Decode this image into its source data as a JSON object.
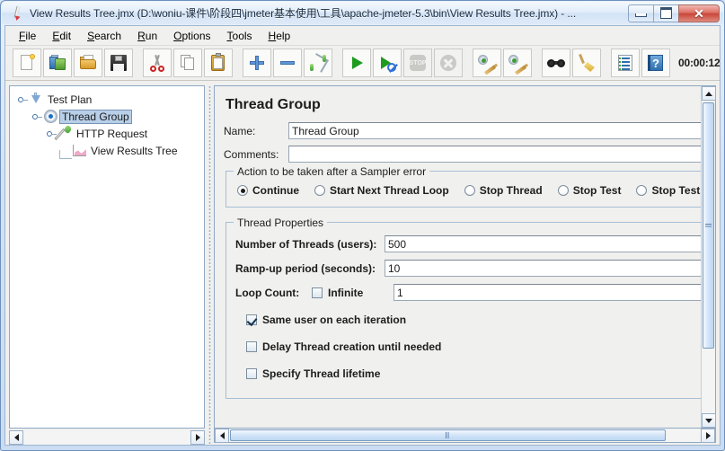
{
  "window": {
    "title": "View Results Tree.jmx (D:\\woniu-课件\\阶段四\\jmeter基本使用\\工具\\apache-jmeter-5.3\\bin\\View Results Tree.jmx) - ...",
    "minimize_label": "",
    "maximize_label": "",
    "close_label": "✕"
  },
  "menubar": {
    "items": [
      {
        "label": "File",
        "mnemonic": "F"
      },
      {
        "label": "Edit",
        "mnemonic": "E"
      },
      {
        "label": "Search",
        "mnemonic": "S"
      },
      {
        "label": "Run",
        "mnemonic": "R"
      },
      {
        "label": "Options",
        "mnemonic": "O"
      },
      {
        "label": "Tools",
        "mnemonic": "T"
      },
      {
        "label": "Help",
        "mnemonic": "H"
      }
    ]
  },
  "toolbar": {
    "buttons": [
      {
        "icon": "new-test-plan-icon",
        "name": "new-button",
        "enabled": true
      },
      {
        "icon": "templates-icon",
        "name": "templates-button",
        "enabled": true
      },
      {
        "icon": "open-folder-icon",
        "name": "open-button",
        "enabled": true
      },
      {
        "icon": "save-disk-icon",
        "name": "save-button",
        "enabled": true
      },
      {
        "icon": "scissors-icon",
        "name": "cut-button",
        "enabled": true
      },
      {
        "icon": "copy-pages-icon",
        "name": "copy-button",
        "enabled": true
      },
      {
        "icon": "clipboard-paste-icon",
        "name": "paste-button",
        "enabled": true
      },
      {
        "icon": "plus-icon",
        "name": "expand-all-button",
        "enabled": true
      },
      {
        "icon": "minus-icon",
        "name": "collapse-all-button",
        "enabled": true
      },
      {
        "icon": "toggle-icon",
        "name": "toggle-button",
        "enabled": true
      },
      {
        "icon": "start-play-icon",
        "name": "start-button",
        "enabled": true
      },
      {
        "icon": "start-no-pauses-icon",
        "name": "start-no-pauses-button",
        "enabled": true
      },
      {
        "icon": "stop-icon",
        "name": "stop-button",
        "enabled": false
      },
      {
        "icon": "shutdown-icon",
        "name": "shutdown-button",
        "enabled": false
      },
      {
        "icon": "clear-icon",
        "name": "clear-button",
        "enabled": true
      },
      {
        "icon": "clear-all-icon",
        "name": "clear-all-button",
        "enabled": true
      },
      {
        "icon": "binoculars-search-icon",
        "name": "search-button",
        "enabled": true
      },
      {
        "icon": "broom-reset-search-icon",
        "name": "reset-search-button",
        "enabled": true
      },
      {
        "icon": "function-helper-icon",
        "name": "function-helper-button",
        "enabled": true
      },
      {
        "icon": "help-book-icon",
        "name": "help-button",
        "enabled": true
      }
    ],
    "timer": "00:00:12"
  },
  "tree": {
    "nodes": [
      {
        "label": "Test Plan",
        "icon": "test-plan-icon",
        "depth": 0,
        "selected": false,
        "expanded": true
      },
      {
        "label": "Thread Group",
        "icon": "thread-group-gear-icon",
        "depth": 1,
        "selected": true,
        "expanded": true
      },
      {
        "label": "HTTP Request",
        "icon": "http-request-pipette-icon",
        "depth": 2,
        "selected": false,
        "expanded": true
      },
      {
        "label": "View Results Tree",
        "icon": "view-results-tree-graph-icon",
        "depth": 3,
        "selected": false,
        "expanded": false
      }
    ]
  },
  "main": {
    "title": "Thread Group",
    "name_label": "Name:",
    "name_value": "Thread Group",
    "comments_label": "Comments:",
    "comments_value": "",
    "sampler_error": {
      "legend": "Action to be taken after a Sampler error",
      "options": [
        {
          "label": "Continue",
          "selected": true
        },
        {
          "label": "Start Next Thread Loop",
          "selected": false
        },
        {
          "label": "Stop Thread",
          "selected": false
        },
        {
          "label": "Stop Test",
          "selected": false
        },
        {
          "label": "Stop Test Now",
          "selected": false
        }
      ]
    },
    "thread_properties": {
      "legend": "Thread Properties",
      "num_threads_label": "Number of Threads (users):",
      "num_threads_value": "500",
      "ramp_up_label": "Ramp-up period (seconds):",
      "ramp_up_value": "10",
      "loop_count_label": "Loop Count:",
      "loop_infinite_label": "Infinite",
      "loop_infinite_checked": false,
      "loop_count_value": "1",
      "checkboxes": [
        {
          "label": "Same user on each iteration",
          "checked": true
        },
        {
          "label": "Delay Thread creation until needed",
          "checked": false
        },
        {
          "label": "Specify Thread lifetime",
          "checked": false
        }
      ]
    }
  },
  "colors": {
    "selection": "#b8cfe8",
    "frame": "#d6e5f5",
    "panel": "#f0f0ee",
    "accent": "#2f6fad"
  }
}
